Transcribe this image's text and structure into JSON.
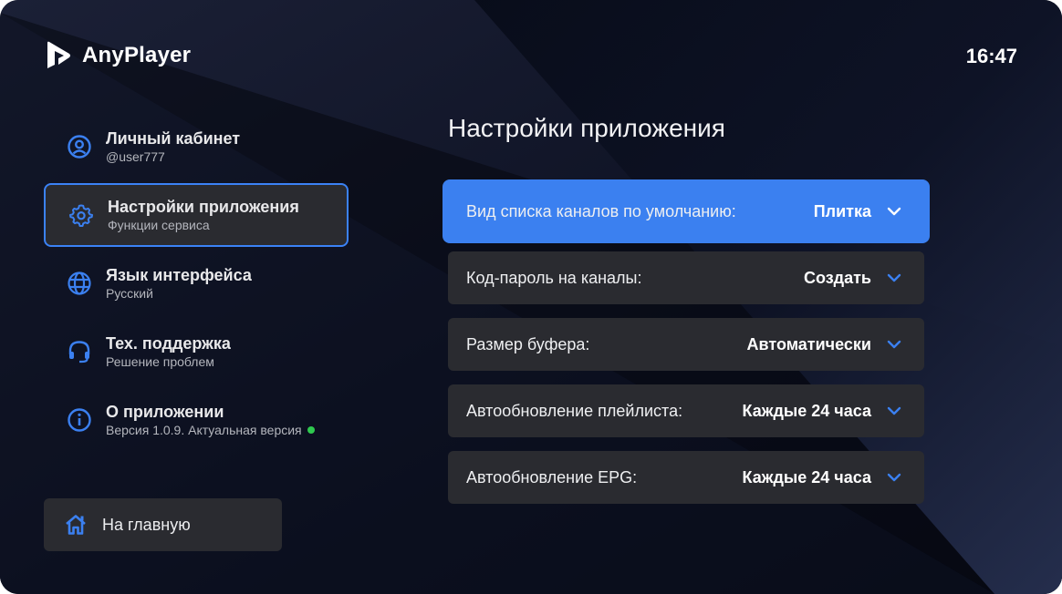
{
  "header": {
    "app_name": "AnyPlayer",
    "clock": "16:47"
  },
  "sidebar": {
    "items": [
      {
        "title": "Личный кабинет",
        "subtitle": "@user777",
        "icon": "user-circle-icon"
      },
      {
        "title": "Настройки приложения",
        "subtitle": "Функции сервиса",
        "icon": "gear-icon"
      },
      {
        "title": "Язык интерфейса",
        "subtitle": "Русский",
        "icon": "globe-icon"
      },
      {
        "title": "Тех. поддержка",
        "subtitle": "Решение проблем",
        "icon": "headset-icon"
      },
      {
        "title": "О приложении",
        "subtitle": "Версия 1.0.9. Актуальная версия",
        "icon": "info-icon"
      }
    ],
    "home_label": "На главную"
  },
  "main": {
    "title": "Настройки приложения",
    "settings": [
      {
        "label": "Вид списка каналов по умолчанию:",
        "value": "Плитка"
      },
      {
        "label": "Код-пароль на каналы:",
        "value": "Создать"
      },
      {
        "label": "Размер буфера:",
        "value": "Автоматически"
      },
      {
        "label": "Автообновление плейлиста:",
        "value": "Каждые 24 часа"
      },
      {
        "label": "Автообновление EPG:",
        "value": "Каждые 24 часа"
      }
    ]
  },
  "colors": {
    "accent": "#3b80f0",
    "status_ok": "#2fc94f",
    "panel": "#2a2b30",
    "background": "#0b0f1e"
  }
}
